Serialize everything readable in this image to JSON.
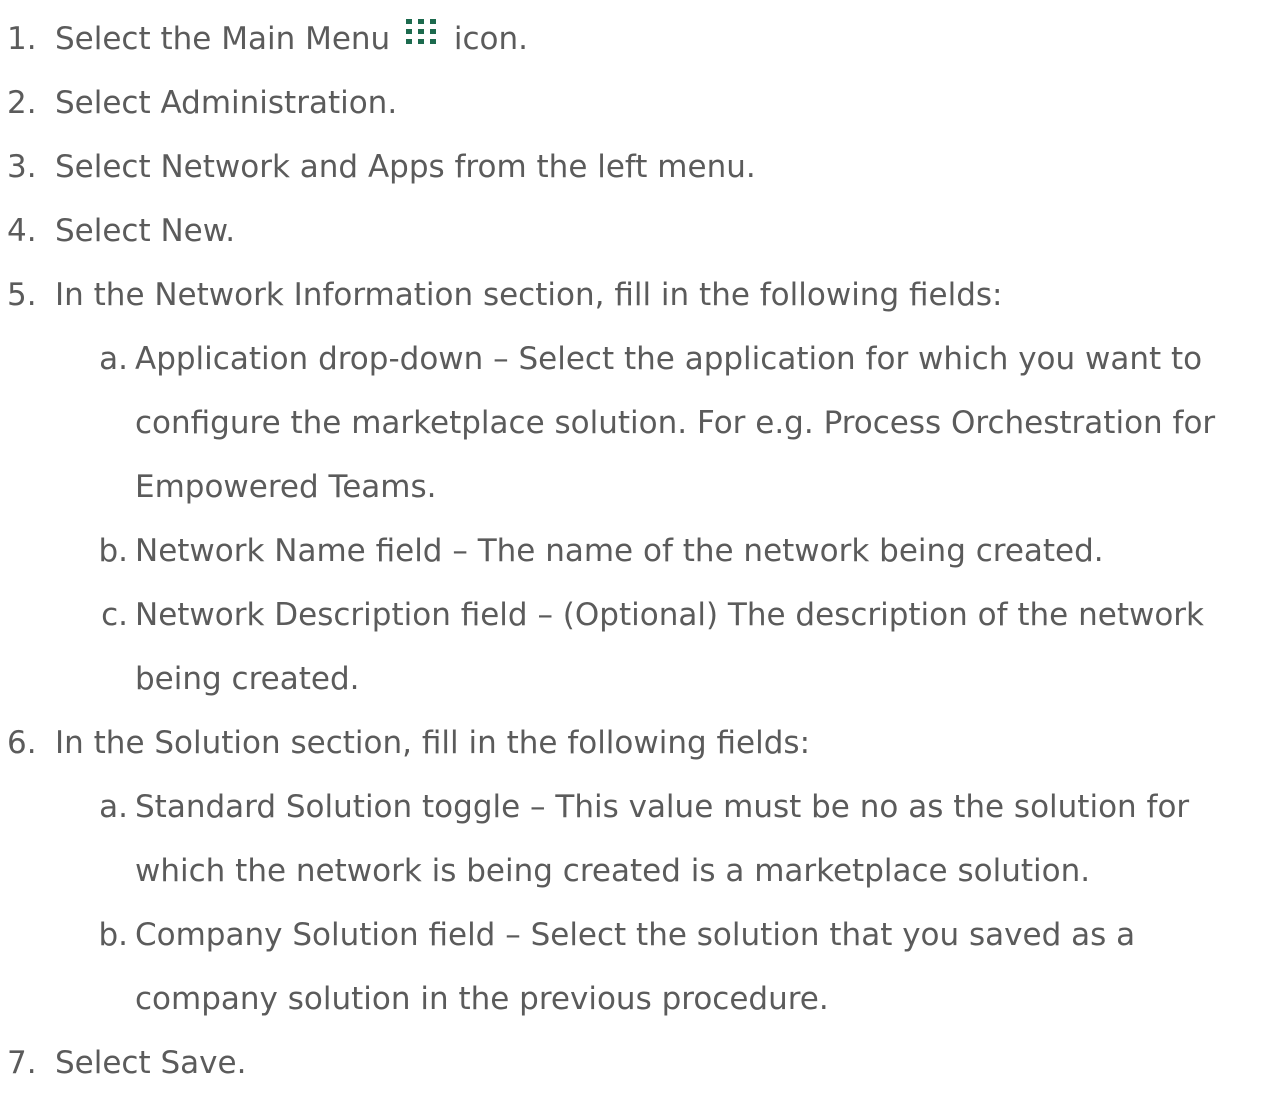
{
  "steps": [
    {
      "num": "1.",
      "text_before": "Select the Main Menu ",
      "icon": "main-menu-grid-icon",
      "text_after": " icon."
    },
    {
      "num": "2.",
      "text": "Select Administration."
    },
    {
      "num": "3.",
      "text": "Select Network and Apps from the left menu."
    },
    {
      "num": "4.",
      "text": "Select New."
    },
    {
      "num": "5.",
      "text": "In the Network Information section, fill in the following fields:",
      "sub": [
        {
          "letter": "a.",
          "text": "Application drop-down – Select the application for which you want to configure the marketplace solution. For e.g. Process Orchestration for Empowered Teams."
        },
        {
          "letter": "b.",
          "text": "Network Name field – The name of the network being created."
        },
        {
          "letter": "c.",
          "text": "Network Description field – (Optional) The description of the network being created."
        }
      ]
    },
    {
      "num": "6.",
      "text": "In the Solution section, fill in the following fields:",
      "sub": [
        {
          "letter": "a.",
          "text": "Standard Solution toggle – This value must be no as the solution for which the network is being created is a marketplace solution."
        },
        {
          "letter": "b.",
          "text": "Company Solution field – Select the solution that you saved as a company solution in the previous procedure."
        }
      ]
    },
    {
      "num": "7.",
      "text": "Select Save."
    }
  ],
  "colors": {
    "text": "#5b5b5b",
    "icon": "#1c6a4e"
  }
}
